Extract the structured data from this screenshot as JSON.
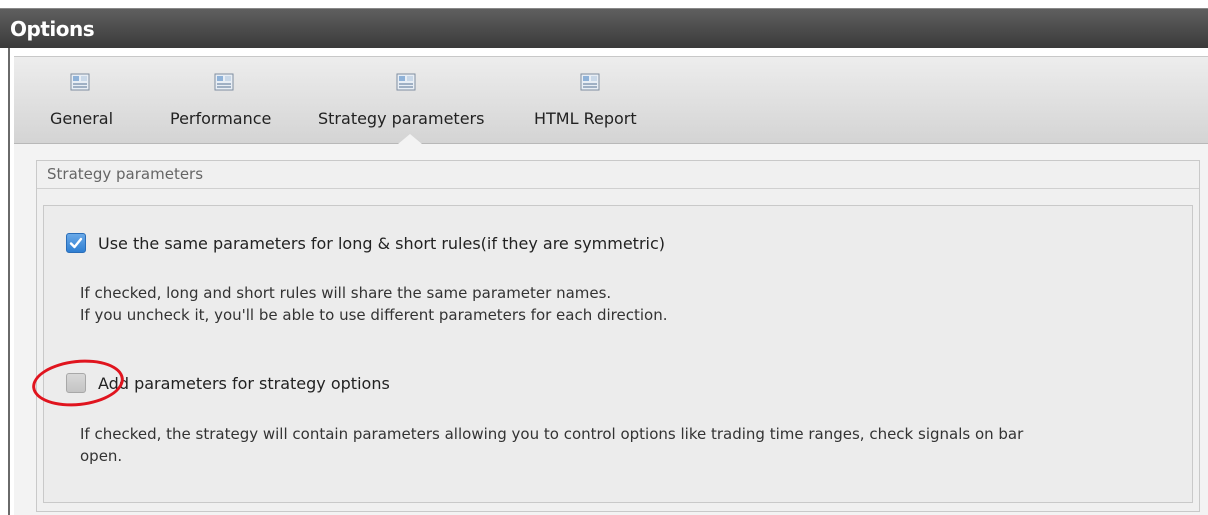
{
  "window": {
    "title": "Options"
  },
  "tabs": [
    {
      "label": "General",
      "icon": "settings-page-icon",
      "selected": false
    },
    {
      "label": "Performance",
      "icon": "settings-page-icon",
      "selected": false
    },
    {
      "label": "Strategy parameters",
      "icon": "settings-page-icon",
      "selected": true
    },
    {
      "label": "HTML Report",
      "icon": "settings-page-icon",
      "selected": false
    }
  ],
  "section": {
    "title": "Strategy parameters",
    "options": [
      {
        "label": "Use the same parameters for long & short rules(if they are symmetric)",
        "checked": true,
        "description_lines": [
          "If checked, long and short rules will share the same parameter names.",
          "If you uncheck it, you'll be able to use different parameters for each direction."
        ]
      },
      {
        "label": "Add parameters for strategy options",
        "checked": false,
        "description_lines": [
          "If checked, the strategy will contain parameters allowing you to control options like trading time ranges, check signals on bar",
          "open."
        ]
      }
    ]
  },
  "colors": {
    "titlebar": "#4a4a4a",
    "checkbox_checked": "#2f7fd2",
    "highlight_ring": "#e0141e"
  }
}
